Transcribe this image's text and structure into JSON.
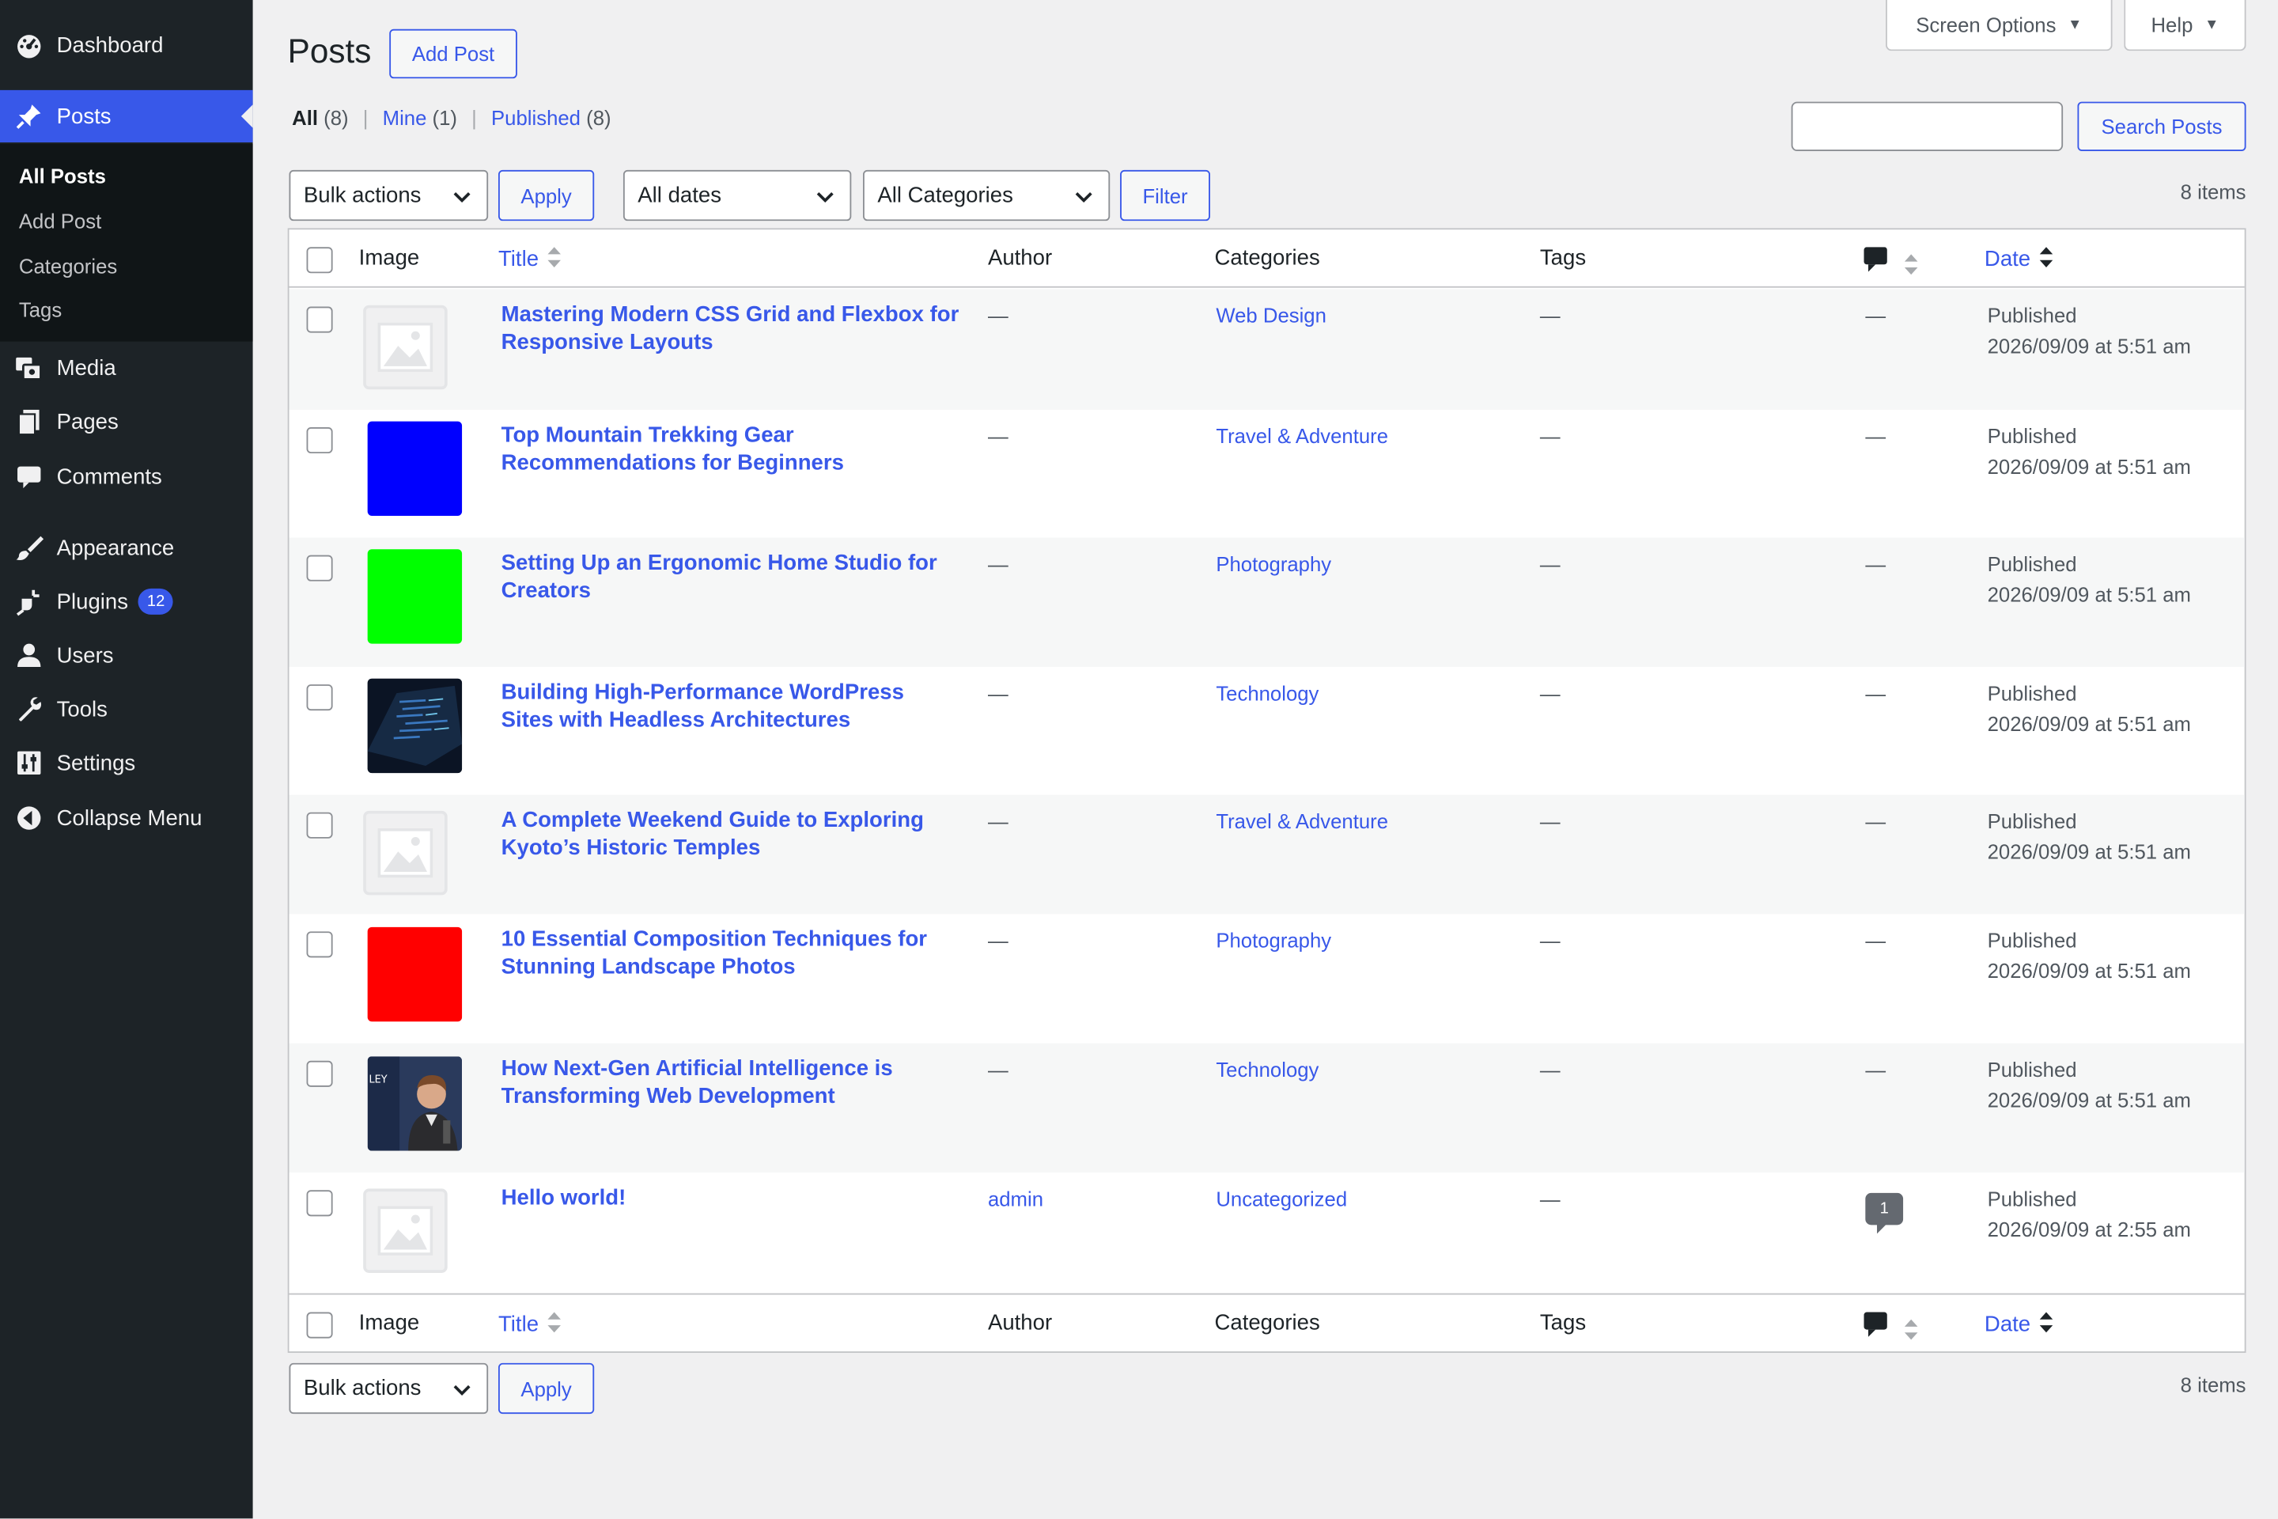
{
  "sidebar": {
    "items": [
      {
        "label": "Dashboard",
        "icon": "dashboard-icon"
      },
      {
        "label": "Posts",
        "icon": "pin-icon"
      },
      {
        "label": "Media",
        "icon": "media-icon"
      },
      {
        "label": "Pages",
        "icon": "pages-icon"
      },
      {
        "label": "Comments",
        "icon": "comments-icon"
      },
      {
        "label": "Appearance",
        "icon": "brush-icon"
      },
      {
        "label": "Plugins",
        "icon": "plugin-icon",
        "badge": "12"
      },
      {
        "label": "Users",
        "icon": "user-icon"
      },
      {
        "label": "Tools",
        "icon": "wrench-icon"
      },
      {
        "label": "Settings",
        "icon": "settings-icon"
      },
      {
        "label": "Collapse Menu",
        "icon": "collapse-icon"
      }
    ],
    "submenu": [
      "All Posts",
      "Add Post",
      "Categories",
      "Tags"
    ]
  },
  "header": {
    "title": "Posts",
    "add_button": "Add Post",
    "screen_options": "Screen Options",
    "help": "Help"
  },
  "filters": {
    "all": "All",
    "all_count": "(8)",
    "mine": "Mine",
    "mine_count": "(1)",
    "published": "Published",
    "published_count": "(8)",
    "sep": "|"
  },
  "search": {
    "button": "Search Posts",
    "value": ""
  },
  "tablenav": {
    "bulk_actions": "Bulk actions",
    "apply": "Apply",
    "dates": "All dates",
    "categories": "All Categories",
    "filter": "Filter",
    "items": "8 items"
  },
  "columns": {
    "image": "Image",
    "title": "Title",
    "author": "Author",
    "categories": "Categories",
    "tags": "Tags",
    "date": "Date"
  },
  "empty": "—",
  "rows": [
    {
      "title": "Mastering Modern CSS Grid and Flexbox for Responsive Layouts",
      "category": "Web Design",
      "status": "Published",
      "date": "2026/09/09 at 5:51 am",
      "thumb": "placeholder"
    },
    {
      "title": "Top Mountain Trekking Gear Recommendations for Beginners",
      "category": "Travel & Adventure",
      "status": "Published",
      "date": "2026/09/09 at 5:51 am",
      "thumb": "#0000ff"
    },
    {
      "title": "Setting Up an Ergonomic Home Studio for Creators",
      "category": "Photography",
      "status": "Published",
      "date": "2026/09/09 at 5:51 am",
      "thumb": "#00ff00"
    },
    {
      "title": "Building High-Performance WordPress Sites with Headless Architectures",
      "category": "Technology",
      "status": "Published",
      "date": "2026/09/09 at 5:51 am",
      "thumb": "code-photo"
    },
    {
      "title": "A Complete Weekend Guide to Exploring Kyoto’s Historic Temples",
      "category": "Travel & Adventure",
      "status": "Published",
      "date": "2026/09/09 at 5:51 am",
      "thumb": "placeholder"
    },
    {
      "title": "10 Essential Composition Techniques for Stunning Landscape Photos",
      "category": "Photography",
      "status": "Published",
      "date": "2026/09/09 at 5:51 am",
      "thumb": "#ff0000"
    },
    {
      "title": "How Next-Gen Artificial Intelligence is Transforming Web Development",
      "category": "Technology",
      "status": "Published",
      "date": "2026/09/09 at 5:51 am",
      "thumb": "person-photo"
    },
    {
      "title": "Hello world!",
      "author": "admin",
      "category": "Uncategorized",
      "status": "Published",
      "date": "2026/09/09 at 2:55 am",
      "thumb": "placeholder",
      "comments": "1"
    }
  ]
}
